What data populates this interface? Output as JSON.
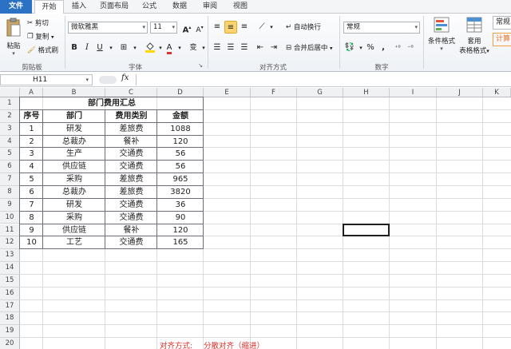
{
  "ribbon_tabs": [
    "文件",
    "开始",
    "插入",
    "页面布局",
    "公式",
    "数据",
    "审阅",
    "视图"
  ],
  "clipboard": {
    "paste": "粘贴",
    "cut": "剪切",
    "copy": "复制",
    "format_painter": "格式刷",
    "group_label": "剪贴板"
  },
  "font": {
    "name": "微软雅黑",
    "size": "11",
    "bold": "B",
    "italic": "I",
    "underline": "U",
    "grow": "A",
    "shrink": "A",
    "font_color_letter": "A",
    "wen": "变",
    "group_label": "字体"
  },
  "alignment": {
    "wrap_text": "自动换行",
    "merge_center": "合并后居中",
    "group_label": "对齐方式"
  },
  "number": {
    "format": "常规",
    "percent": "%",
    "comma": ",",
    "group_label": "数字"
  },
  "styles": {
    "conditional_format": "条件格式",
    "table_format_line1": "套用",
    "table_format_line2": "表格格式",
    "style_normal": "常规",
    "style_calc": "计算"
  },
  "formula_bar": {
    "cell_ref": "H11",
    "fx": "fx",
    "content": ""
  },
  "columns": [
    "A",
    "B",
    "C",
    "D",
    "E",
    "F",
    "G",
    "H",
    "I",
    "J",
    "K"
  ],
  "rows": [
    "1",
    "2",
    "3",
    "4",
    "5",
    "6",
    "7",
    "8",
    "9",
    "10",
    "11",
    "12",
    "13",
    "14",
    "15",
    "16",
    "17",
    "18",
    "19",
    "20"
  ],
  "table": {
    "title": "部门费用汇总",
    "headers": [
      "序号",
      "部门",
      "费用类别",
      "金额"
    ],
    "rows": [
      [
        "1",
        "研发",
        "差旅费",
        "1088"
      ],
      [
        "2",
        "总裁办",
        "餐补",
        "120"
      ],
      [
        "3",
        "生产",
        "交通费",
        "56"
      ],
      [
        "4",
        "供应链",
        "交通费",
        "56"
      ],
      [
        "5",
        "采购",
        "差旅费",
        "965"
      ],
      [
        "6",
        "总裁办",
        "差旅费",
        "3820"
      ],
      [
        "7",
        "研发",
        "交通费",
        "36"
      ],
      [
        "8",
        "采购",
        "交通费",
        "90"
      ],
      [
        "9",
        "供应链",
        "餐补",
        "120"
      ],
      [
        "10",
        "工艺",
        "交通费",
        "165"
      ]
    ]
  },
  "note": {
    "label": "对齐方式:",
    "value": "分散对齐（缩进）"
  },
  "colors": {
    "file_tab": "#2b72c4",
    "active_align": "#fbd46f",
    "note_red": "#e0302a"
  }
}
